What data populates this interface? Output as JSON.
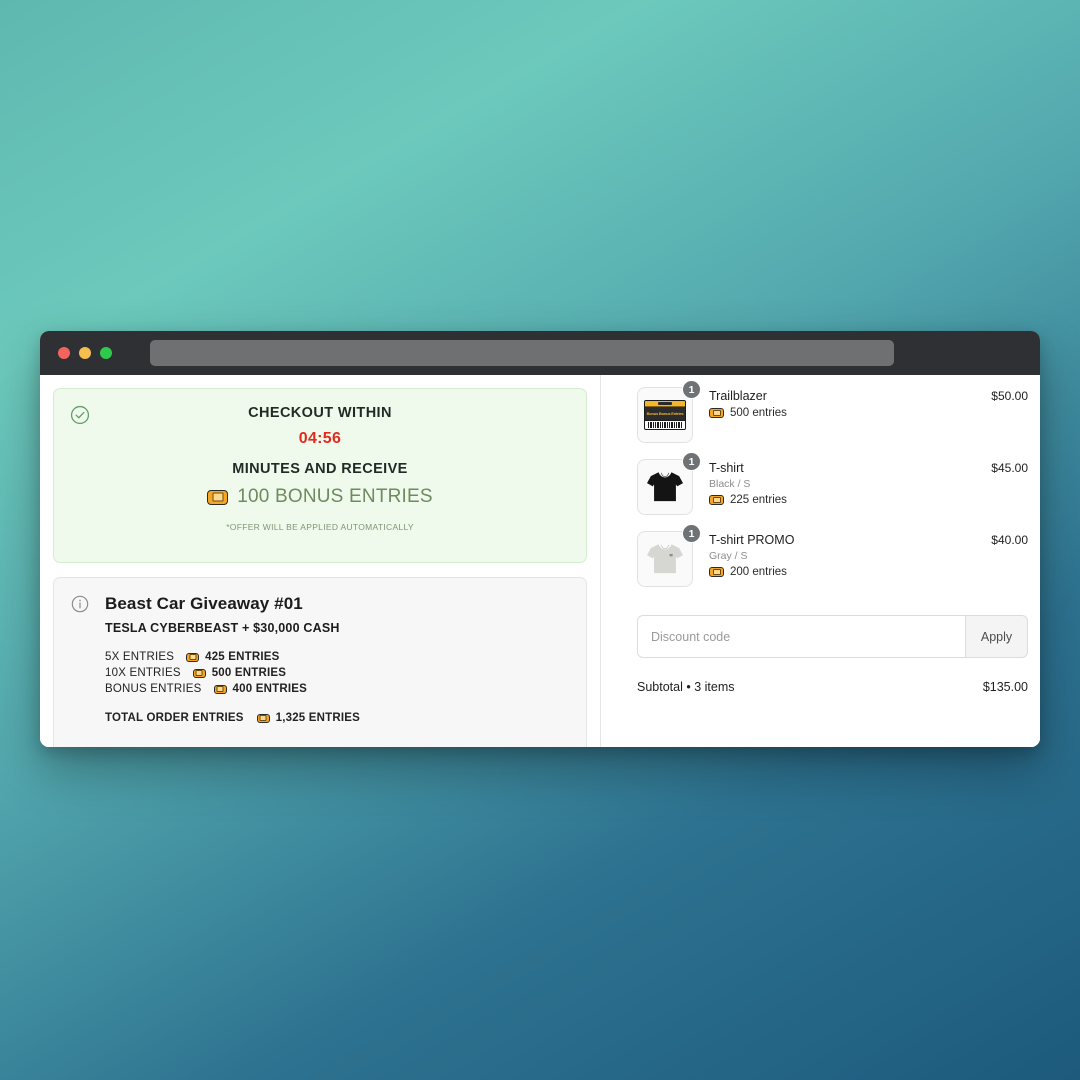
{
  "window": {
    "traffic_lights": [
      "close",
      "minimize",
      "maximize"
    ],
    "url_value": ""
  },
  "promo": {
    "check_icon": "check-circle-icon",
    "line1": "CHECKOUT WITHIN",
    "timer": "04:56",
    "timer_color": "#e02b1e",
    "line2": "MINUTES AND RECEIVE",
    "bonus_icon": "ticket-icon",
    "bonus_text": "100 BONUS ENTRIES",
    "bonus_color": "#6e8a5f",
    "footnote": "*OFFER WILL BE APPLIED AUTOMATICALLY",
    "card_bg": "#effaed",
    "card_border": "#d5ecd0"
  },
  "giveaway": {
    "info_icon": "info-circle-icon",
    "title": "Beast Car Giveaway #01",
    "subtitle": "TESLA CYBERBEAST + $30,000 CASH",
    "rows": [
      {
        "label": "5X ENTRIES",
        "icon": "ticket-icon",
        "value": "425 ENTRIES"
      },
      {
        "label": "10X ENTRIES",
        "icon": "ticket-icon",
        "value": "500 ENTRIES"
      },
      {
        "label": "BONUS ENTRIES",
        "icon": "ticket-icon",
        "value": "400 ENTRIES"
      }
    ],
    "total": {
      "label": "TOTAL ORDER ENTRIES",
      "icon": "ticket-icon",
      "value": "1,325 ENTRIES"
    }
  },
  "cart": {
    "items": [
      {
        "thumb": "ticket-product-image",
        "thumb_caption": "Bonus Bonus Entries",
        "qty": "1",
        "name": "Trailblazer",
        "variant": "",
        "entries_icon": "ticket-icon",
        "entries": "500 entries",
        "price": "$50.00"
      },
      {
        "thumb": "black-tshirt-image",
        "thumb_caption": "",
        "qty": "1",
        "name": "T-shirt",
        "variant": "Black / S",
        "entries_icon": "ticket-icon",
        "entries": "225 entries",
        "price": "$45.00"
      },
      {
        "thumb": "gray-tshirt-image",
        "thumb_caption": "",
        "qty": "1",
        "name": "T-shirt PROMO",
        "variant": "Gray / S",
        "entries_icon": "ticket-icon",
        "entries": "200 entries",
        "price": "$40.00"
      }
    ],
    "discount_placeholder": "Discount code",
    "discount_value": "",
    "apply_label": "Apply",
    "subtotal_label": "Subtotal • 3 items",
    "subtotal_value": "$135.00"
  },
  "colors": {
    "accent_orange": "#f6a623",
    "timer_red": "#e02b1e",
    "promo_green": "#6e8a5f",
    "titlebar": "#2e3033",
    "bg_top": "#6cc9bc",
    "bg_bottom": "#1d5a7c"
  }
}
